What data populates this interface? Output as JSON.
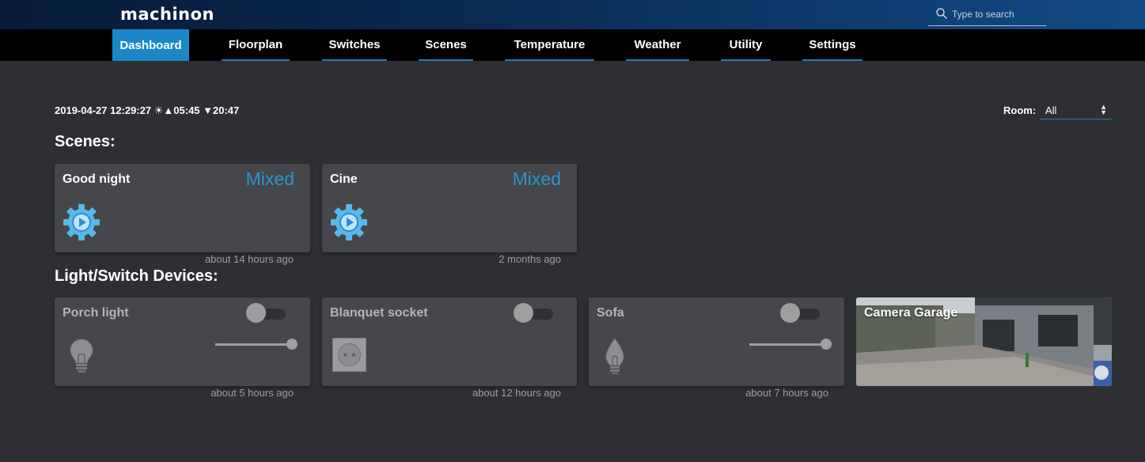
{
  "app": {
    "logo": "machinon"
  },
  "search": {
    "placeholder": "Type to search"
  },
  "nav": {
    "tabs": [
      {
        "label": "Dashboard"
      },
      {
        "label": "Floorplan"
      },
      {
        "label": "Switches"
      },
      {
        "label": "Scenes"
      },
      {
        "label": "Temperature"
      },
      {
        "label": "Weather"
      },
      {
        "label": "Utility"
      },
      {
        "label": "Settings"
      }
    ],
    "active": "Dashboard"
  },
  "status": {
    "datetime": "2019-04-27 12:29:27 ☀▲05:45 ▼20:47"
  },
  "room_filter": {
    "label": "Room:",
    "value": "All"
  },
  "scenes": {
    "title": "Scenes:",
    "items": [
      {
        "name": "Good night",
        "status": "Mixed",
        "updated": "about 14 hours ago"
      },
      {
        "name": "Cine",
        "status": "Mixed",
        "updated": "2 months ago"
      }
    ]
  },
  "devices": {
    "title": "Light/Switch Devices:",
    "items": [
      {
        "name": "Porch light",
        "updated": "about 5 hours ago",
        "icon": "light-bulb-icon",
        "state": "off",
        "dimmer_level": 1.0
      },
      {
        "name": "Blanquet socket",
        "updated": "about 12 hours ago",
        "icon": "wall-socket-icon",
        "state": "off"
      },
      {
        "name": "Sofa",
        "updated": "about 7 hours ago",
        "icon": "candle-bulb-icon",
        "state": "off",
        "dimmer_level": 1.0
      },
      {
        "name": "Camera Garage",
        "icon": "camera-snapshot"
      }
    ]
  },
  "colors": {
    "header_gradient": [
      "#061b35",
      "#124a85"
    ],
    "accent": "#1b87c9",
    "status_blue": "#2696d6",
    "background": "#2e2f33",
    "card": "#46474b"
  }
}
